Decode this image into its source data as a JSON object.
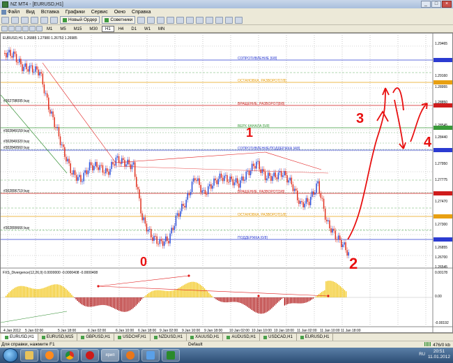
{
  "window": {
    "title": "NZ MT4 - [EURUSD,H1]",
    "controls": [
      "_",
      "□",
      "×"
    ]
  },
  "menu": [
    "Файл",
    "Вид",
    "Вставка",
    "Графики",
    "Сервис",
    "Окно",
    "Справка"
  ],
  "toolbar": {
    "new_order_label": "Новый Ордер",
    "advisors_label": "Советники"
  },
  "timeframes": [
    "M1",
    "M5",
    "M15",
    "M30",
    "H1",
    "H4",
    "D1",
    "W1",
    "MN"
  ],
  "active_timeframe": "H1",
  "chart": {
    "symbol_header": "EURUSD,H1  1.26885 1.27980 1.26753 1.26985",
    "price_ticks": [
      "1.29465",
      "1.29360",
      "1.29160",
      "1.28955",
      "1.28850",
      "1.28545",
      "1.28440",
      "1.28174",
      "1.27950",
      "1.27775",
      "1.27470",
      "1.27300",
      "1.26855",
      "1.26700",
      "1.26545"
    ],
    "level_labels": [
      {
        "text": "СОПРОТИВЛЕНИЕ [6/8]",
        "color": "#2b3bd1"
      },
      {
        "text": "ОСТАНОВКА, РАЗВОРОТ[7/8]",
        "color": "#e8a012"
      },
      {
        "text": "ВРАЩЕНИЕ, РАЗВОРОТ[8/8]",
        "color": "#cf1c1c"
      },
      {
        "text": "ВЕРХ КАНАЛА [5/8]",
        "color": "#3a9a3a"
      },
      {
        "text": "СОПРОТИВЛЕНИЕ/ПОДДЕРЖКА [4/8]",
        "color": "#2b3bd1"
      },
      {
        "text": "ВРАЩЕНИЕ, РАЗВОРОТ[3/8]",
        "color": "#cf1c1c"
      },
      {
        "text": "ОСТАНОВКА, РАЗВОРОТ[1/8]",
        "color": "#e8a012"
      },
      {
        "text": "ПОДДЕРЖКА [0/8]",
        "color": "#2b3bd1"
      }
    ],
    "order_labels": [
      "#302798095 buy",
      "#302849159 buy",
      "#302849320 buy",
      "#302849560 buy",
      "#302896719 buy",
      "#302899666 buy"
    ],
    "indicator_header": "FXS_Divergence(12,26,9) 0.0000000 -0.0000408 -0.0000408",
    "indicator_ticks": [
      "0.00178",
      "0.00",
      "-0.00192"
    ],
    "time_labels": [
      "4 Jan 2012",
      "5 Jan 02:00",
      "5 Jan 18:00",
      "6 Jan 02:00",
      "6 Jan 10:00",
      "6 Jan 18:00",
      "9 Jan 02:00",
      "9 Jan 10:00",
      "9 Jan 18:00",
      "10 Jan 02:00",
      "10 Jan 10:00",
      "10 Jan 18:00",
      "11 Jan 02:00",
      "11 Jan 10:00",
      "11 Jan 18:00"
    ],
    "annotations": [
      "0",
      "1",
      "2",
      "3",
      "4"
    ]
  },
  "chart_tabs": [
    "EURUSD,H1",
    "EURUSD,M15",
    "GBPUSD,H1",
    "USDCHF,H1",
    "NZDUSD,H1",
    "XAUUSD,H1",
    "AUDUSD,H1",
    "USDCAD,H1",
    "EURUSD,H1"
  ],
  "status": {
    "help": "Для справки, нажмите F1",
    "profile": "Default",
    "traffic": "476/0 kb"
  },
  "taskbar": {
    "lang": "RU",
    "time": "20:51",
    "date": "11.01.2012",
    "active_label": "ярип"
  },
  "colors": {
    "bull": "#2a4bd6",
    "bear": "#e0301e",
    "hist_up": "#f0c000",
    "hist_down": "#a80000",
    "marker": "#e01818"
  }
}
